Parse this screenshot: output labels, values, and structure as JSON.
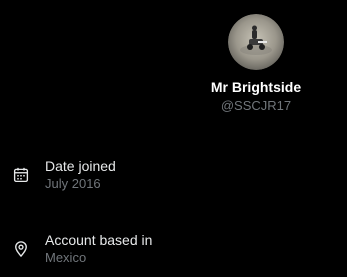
{
  "profile": {
    "display_name": "Mr Brightside",
    "handle": "@SSCJR17",
    "avatar_icon": "profile-avatar"
  },
  "details": [
    {
      "icon": "calendar-icon",
      "label": "Date joined",
      "value": "July 2016"
    },
    {
      "icon": "location-pin-icon",
      "label": "Account based in",
      "value": "Mexico"
    }
  ],
  "colors": {
    "background": "#000000",
    "primary_text": "#e7e9ea",
    "secondary_text": "#71767b"
  }
}
